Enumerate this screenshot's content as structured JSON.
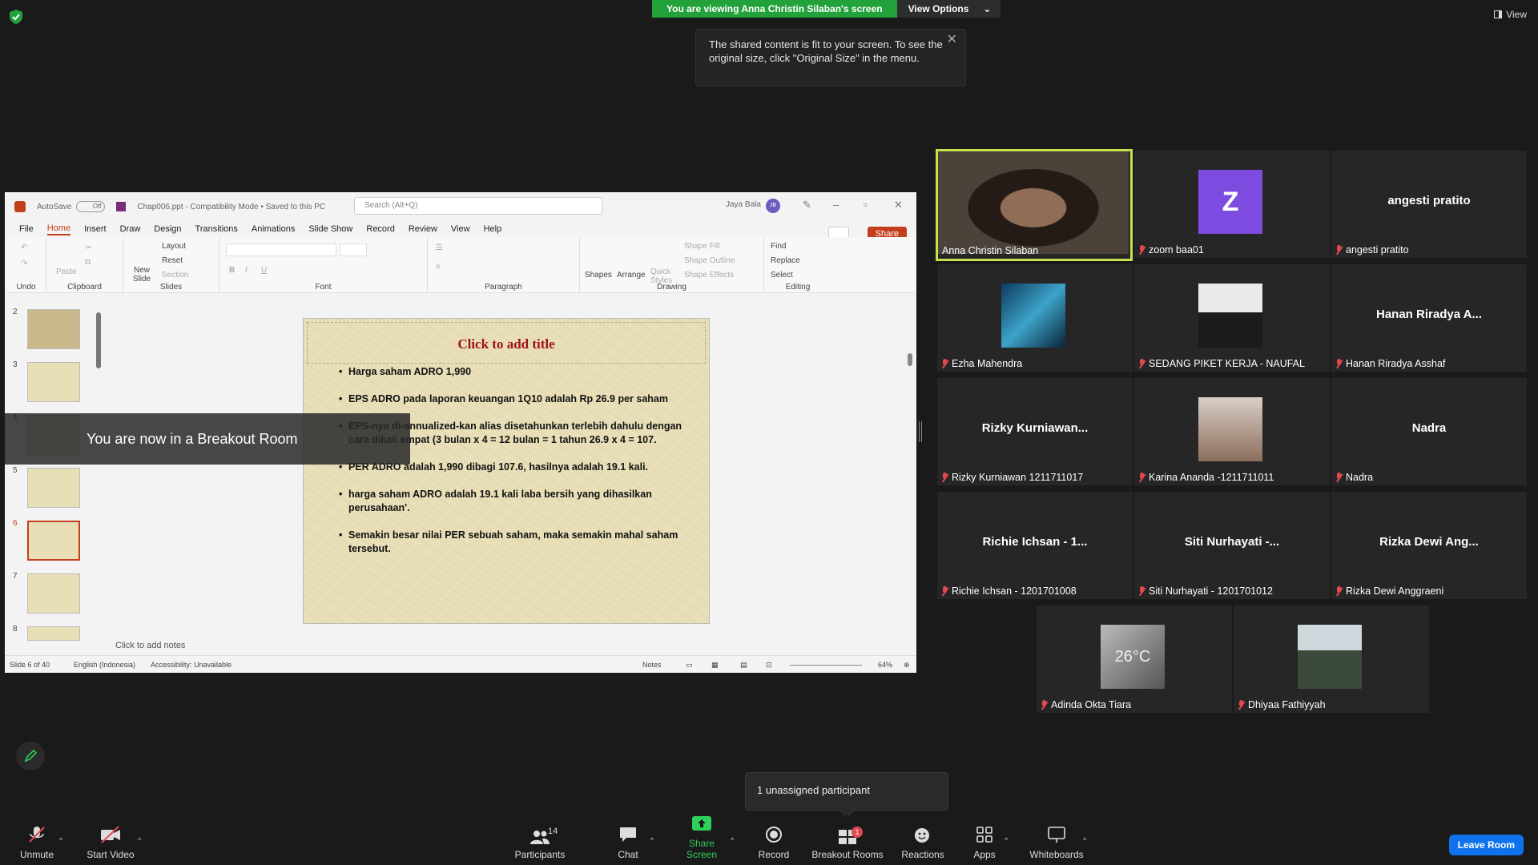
{
  "share": {
    "banner_text": "You are viewing Anna Christin Silaban's screen",
    "view_options_label": "View Options",
    "view_label": "View",
    "tooltip_text": "The shared content is fit to your screen. To see the original size, click \"Original Size\" in the menu."
  },
  "ppt": {
    "autosave_label": "AutoSave",
    "autosave_state": "Off",
    "file_title": "Chap006.ppt - Compatibility Mode • Saved to this PC",
    "search_placeholder": "Search (Alt+Q)",
    "user_name": "Jaya Bala",
    "user_initials": "JB",
    "menu": [
      "File",
      "Home",
      "Insert",
      "Draw",
      "Design",
      "Transitions",
      "Animations",
      "Slide Show",
      "Record",
      "Review",
      "View",
      "Help"
    ],
    "active_menu": "Home",
    "share_label": "Share",
    "ribbon": {
      "groups": [
        "Undo",
        "Clipboard",
        "Slides",
        "Font",
        "Paragraph",
        "Drawing",
        "Editing"
      ],
      "paste": "Paste",
      "new_slide": "New Slide",
      "layout": "Layout",
      "reset": "Reset",
      "section": "Section",
      "shapes": "Shapes",
      "arrange": "Arrange",
      "quick_styles": "Quick Styles",
      "shape_fill": "Shape Fill",
      "shape_outline": "Shape Outline",
      "shape_effects": "Shape Effects",
      "find": "Find",
      "replace": "Replace",
      "select": "Select"
    },
    "thumb_numbers": [
      "2",
      "3",
      "4",
      "5",
      "6",
      "7",
      "8"
    ],
    "selected_slide": "6",
    "slide": {
      "title_placeholder": "Click to add title",
      "bullets": [
        "Harga saham ADRO 1,990",
        "EPS ADRO pada laporan keuangan 1Q10 adalah Rp 26.9 per saham",
        "EPS-nya di-annualized-kan alias disetahunkan terlebih dahulu dengan cara dikali empat (3 bulan x 4 = 12 bulan = 1 tahun 26.9 x 4 = 107.",
        "PER ADRO adalah 1,990 dibagi 107.6, hasilnya adalah 19.1 kali.",
        "harga saham ADRO adalah 19.1 kali laba bersih yang dihasilkan perusahaan'.",
        "Semakin besar nilai PER sebuah saham, maka semakin mahal saham tersebut."
      ]
    },
    "notes_placeholder": "Click to add notes",
    "status": {
      "slide_count": "Slide 6 of 40",
      "language": "English (Indonesia)",
      "accessibility": "Accessibility: Unavailable",
      "notes_label": "Notes",
      "zoom": "64%"
    }
  },
  "breakout_overlay": "You are now in a Breakout Room",
  "participants": [
    {
      "name": "Anna Christin Silaban",
      "muted": false,
      "display": "video"
    },
    {
      "name": "zoom baa01",
      "muted": true,
      "display": "avatar",
      "avatar_letter": "Z"
    },
    {
      "name": "angesti pratito",
      "muted": true,
      "display": "text",
      "big": "angesti pratito"
    },
    {
      "name": "Ezha Mahendra",
      "muted": true,
      "display": "photo"
    },
    {
      "name": "SEDANG PIKET KERJA - NAUFAL",
      "muted": true,
      "display": "photo"
    },
    {
      "name": "Hanan Riradya Asshaf",
      "muted": true,
      "display": "text",
      "big": "Hanan Riradya A..."
    },
    {
      "name": "Rizky Kurniawan 1211711017",
      "muted": true,
      "display": "text",
      "big": "Rizky  Kurniawan..."
    },
    {
      "name": "Karina Ananda -1211711011",
      "muted": true,
      "display": "photo"
    },
    {
      "name": "Nadra",
      "muted": true,
      "display": "text",
      "big": "Nadra"
    },
    {
      "name": "Richie Ichsan - 1201701008",
      "muted": true,
      "display": "text",
      "big": "Richie Ichsan - 1..."
    },
    {
      "name": "Siti Nurhayati - 1201701012",
      "muted": true,
      "display": "text",
      "big": "Siti Nurhayati -..."
    },
    {
      "name": "Rizka Dewi Anggraeni",
      "muted": true,
      "display": "text",
      "big": "Rizka Dewi Ang..."
    },
    {
      "name": "Adinda Okta Tiara",
      "muted": true,
      "display": "photo",
      "photo_text": "26°C"
    },
    {
      "name": "Dhiyaa Fathiyyah",
      "muted": true,
      "display": "photo"
    }
  ],
  "unassigned_popup": "1 unassigned participant",
  "toolbar": {
    "unmute": "Unmute",
    "start_video": "Start Video",
    "participants": "Participants",
    "participants_count": "14",
    "chat": "Chat",
    "share_screen": "Share Screen",
    "record": "Record",
    "breakout_rooms": "Breakout Rooms",
    "breakout_badge": "1",
    "reactions": "Reactions",
    "apps": "Apps",
    "whiteboards": "Whiteboards",
    "leave_room": "Leave Room"
  },
  "colors": {
    "share_green": "#23a23c",
    "active_speaker": "#c7e04e",
    "mute_red": "#e34850",
    "leave_blue": "#0e72ed",
    "ppt_accent": "#c43e1c",
    "slide_title": "#a0111c"
  }
}
